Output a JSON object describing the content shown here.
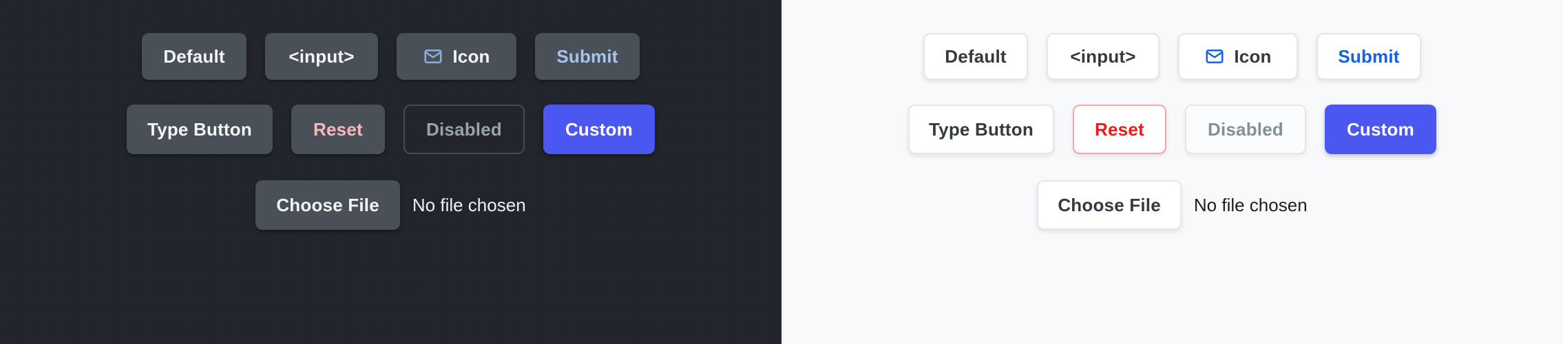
{
  "theme_colors": {
    "dark_background": "#22262c",
    "light_background": "#f8f9fa",
    "dark_button_surface": "#4a5058",
    "light_button_surface": "#ffffff",
    "primary_accent": "#4a57f0",
    "dark_submit_text": "#a8c3ea",
    "light_submit_text": "#1361e8",
    "dark_reset_text": "#f7b8bd",
    "light_reset_text": "#f01818",
    "light_reset_border": "#f9a3a3",
    "disabled_text_dark": "#9aa2ad",
    "disabled_text_light": "#868e96"
  },
  "panels": [
    {
      "theme": "dark",
      "rows": [
        {
          "name": "primary-variants",
          "buttons": [
            {
              "label": "Default",
              "variant": "solid",
              "icon": null,
              "width_class": "w-default"
            },
            {
              "label": "<input>",
              "variant": "solid",
              "icon": null,
              "width_class": "w-input"
            },
            {
              "label": "Icon",
              "variant": "solid",
              "icon": "mail-icon",
              "width_class": "w-icon"
            },
            {
              "label": "Submit",
              "variant": "accent",
              "icon": null,
              "width_class": "w-submit"
            }
          ]
        },
        {
          "name": "type-variants",
          "buttons": [
            {
              "label": "Type Button",
              "variant": "solid",
              "icon": null,
              "width_class": "w-type"
            },
            {
              "label": "Reset",
              "variant": "danger",
              "icon": null,
              "width_class": "w-reset"
            },
            {
              "label": "Disabled",
              "variant": "disabled",
              "icon": null,
              "width_class": "w-disabled"
            },
            {
              "label": "Custom",
              "variant": "primary",
              "icon": null,
              "width_class": "w-custom"
            }
          ]
        }
      ],
      "file_input": {
        "button_label": "Choose File",
        "status_text": "No file chosen"
      }
    },
    {
      "theme": "light",
      "rows": [
        {
          "name": "primary-variants",
          "buttons": [
            {
              "label": "Default",
              "variant": "solid",
              "icon": null,
              "width_class": "w-default"
            },
            {
              "label": "<input>",
              "variant": "solid",
              "icon": null,
              "width_class": "w-input"
            },
            {
              "label": "Icon",
              "variant": "solid",
              "icon": "mail-icon",
              "width_class": "w-icon"
            },
            {
              "label": "Submit",
              "variant": "accent",
              "icon": null,
              "width_class": "w-submit"
            }
          ]
        },
        {
          "name": "type-variants",
          "buttons": [
            {
              "label": "Type Button",
              "variant": "solid",
              "icon": null,
              "width_class": "w-type"
            },
            {
              "label": "Reset",
              "variant": "danger",
              "icon": null,
              "width_class": "w-reset"
            },
            {
              "label": "Disabled",
              "variant": "disabled",
              "icon": null,
              "width_class": "w-disabled"
            },
            {
              "label": "Custom",
              "variant": "primary",
              "icon": null,
              "width_class": "w-custom"
            }
          ]
        }
      ],
      "file_input": {
        "button_label": "Choose File",
        "status_text": "No file chosen"
      }
    }
  ]
}
